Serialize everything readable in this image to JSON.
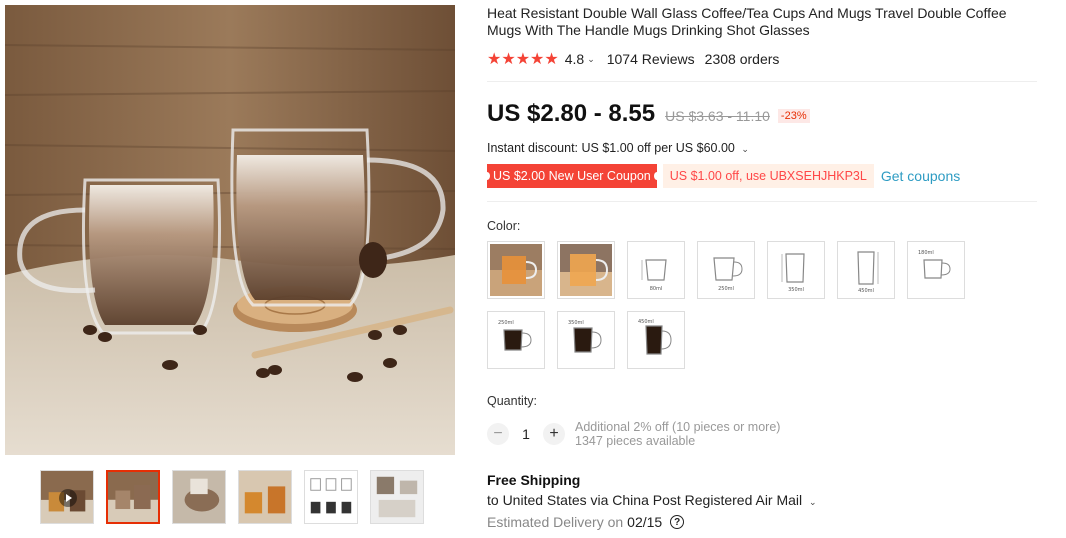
{
  "product": {
    "title": "Heat Resistant Double Wall Glass Coffee/Tea Cups And Mugs Travel Double Coffee Mugs With The Handle Mugs Drinking Shot Glasses",
    "stars": "★★★★★",
    "rating": "4.8",
    "reviews": "1074 Reviews",
    "orders": "2308 orders"
  },
  "price": {
    "current": "US $2.80 - 8.55",
    "original": "US $3.63 - 11.10",
    "discount_badge": "-23%"
  },
  "promo": {
    "instant_discount": "Instant discount: US $1.00 off per US $60.00",
    "new_user_coupon": "US $2.00 New User Coupon",
    "code_coupon": "US $1.00 off, use UBXSEHJHKP3L",
    "get_coupons": "Get coupons"
  },
  "color": {
    "label": "Color:",
    "options": [
      {
        "name": "photo-1",
        "size": ""
      },
      {
        "name": "photo-2",
        "size": ""
      },
      {
        "name": "spec-1",
        "size": "80ml"
      },
      {
        "name": "spec-2",
        "size": "250ml"
      },
      {
        "name": "spec-3",
        "size": "350ml"
      },
      {
        "name": "spec-4",
        "size": "450ml"
      },
      {
        "name": "spec-5",
        "size": "180ml"
      },
      {
        "name": "spec-6",
        "size": "250ml"
      },
      {
        "name": "spec-7",
        "size": "350ml"
      },
      {
        "name": "spec-8",
        "size": "450ml"
      }
    ]
  },
  "quantity": {
    "label": "Quantity:",
    "value": "1",
    "minus": "−",
    "plus": "+",
    "note": "Additional 2% off (10 pieces or more)",
    "available": "1347 pieces available"
  },
  "shipping": {
    "title": "Free Shipping",
    "route": "to United States via China Post Registered Air Mail",
    "delivery_label": "Estimated Delivery on",
    "delivery_date": "02/15",
    "help_icon_glyph": "?"
  },
  "icons": {
    "caret": "⌄",
    "colors": {
      "accent": "#f44336",
      "link": "#2e9cc3",
      "coupon_bg": "#fff0e6"
    }
  }
}
